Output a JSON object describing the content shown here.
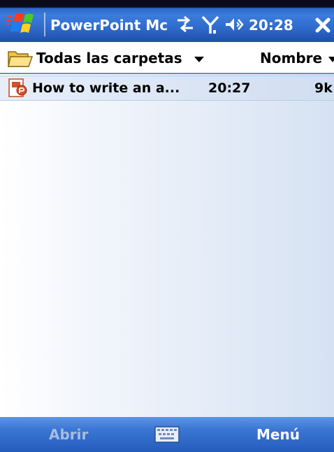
{
  "titlebar": {
    "app_title": "PowerPoint Mc",
    "clock": "20:28",
    "icons": {
      "start": "windows-flag-icon",
      "connectivity": "connectivity-icon",
      "signal": "signal-icon",
      "volume": "volume-icon",
      "close": "close-icon"
    }
  },
  "header": {
    "folder_label": "Todas las carpetas",
    "sort_label": "Nombre"
  },
  "files": [
    {
      "name": "How to write an a...",
      "time": "20:27",
      "size": "9k"
    }
  ],
  "softkeys": {
    "left": "Abrir",
    "right": "Menú"
  },
  "colors": {
    "titlebar": "#2f6bcc",
    "softkey_bar": "#3b76d4",
    "selected_row": "#d1def1",
    "disabled_softkey": "#a7bddf"
  }
}
